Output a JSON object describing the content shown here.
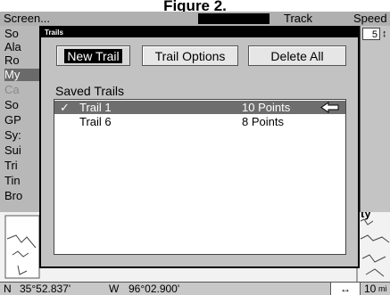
{
  "caption": "Figure 2.",
  "topbar": {
    "left": "Screen...",
    "track": "Track",
    "speed": "Speed"
  },
  "menu": {
    "items": [
      {
        "label": "So"
      },
      {
        "label": "Ala"
      },
      {
        "label": "Ro"
      },
      {
        "label": "My"
      },
      {
        "label": "Ca"
      },
      {
        "label": "So"
      },
      {
        "label": "GP"
      },
      {
        "label": "Sy:"
      },
      {
        "label": "Sui"
      },
      {
        "label": "Tri"
      },
      {
        "label": "Tin"
      },
      {
        "label": "Bro"
      }
    ]
  },
  "right_col": {
    "scale_mark": "5",
    "updown": "↕"
  },
  "dialog": {
    "title": "Trails",
    "buttons": {
      "new_trail": "New Trail",
      "trail_options": "Trail Options",
      "delete_all": "Delete All"
    },
    "saved_label": "Saved Trails",
    "trails": [
      {
        "check": "✓",
        "name": "Trail 1",
        "points": "10 Points",
        "selected": true
      },
      {
        "check": "",
        "name": "Trail 6",
        "points": "8 Points",
        "selected": false
      }
    ]
  },
  "map_text": {
    "ty": "ty"
  },
  "status": {
    "lat_hemi": "N",
    "lat": "35°52.837'",
    "lon_hemi": "W",
    "lon": "96°02.900'",
    "arrow": "↔",
    "scale": "10",
    "unit": "mi"
  }
}
